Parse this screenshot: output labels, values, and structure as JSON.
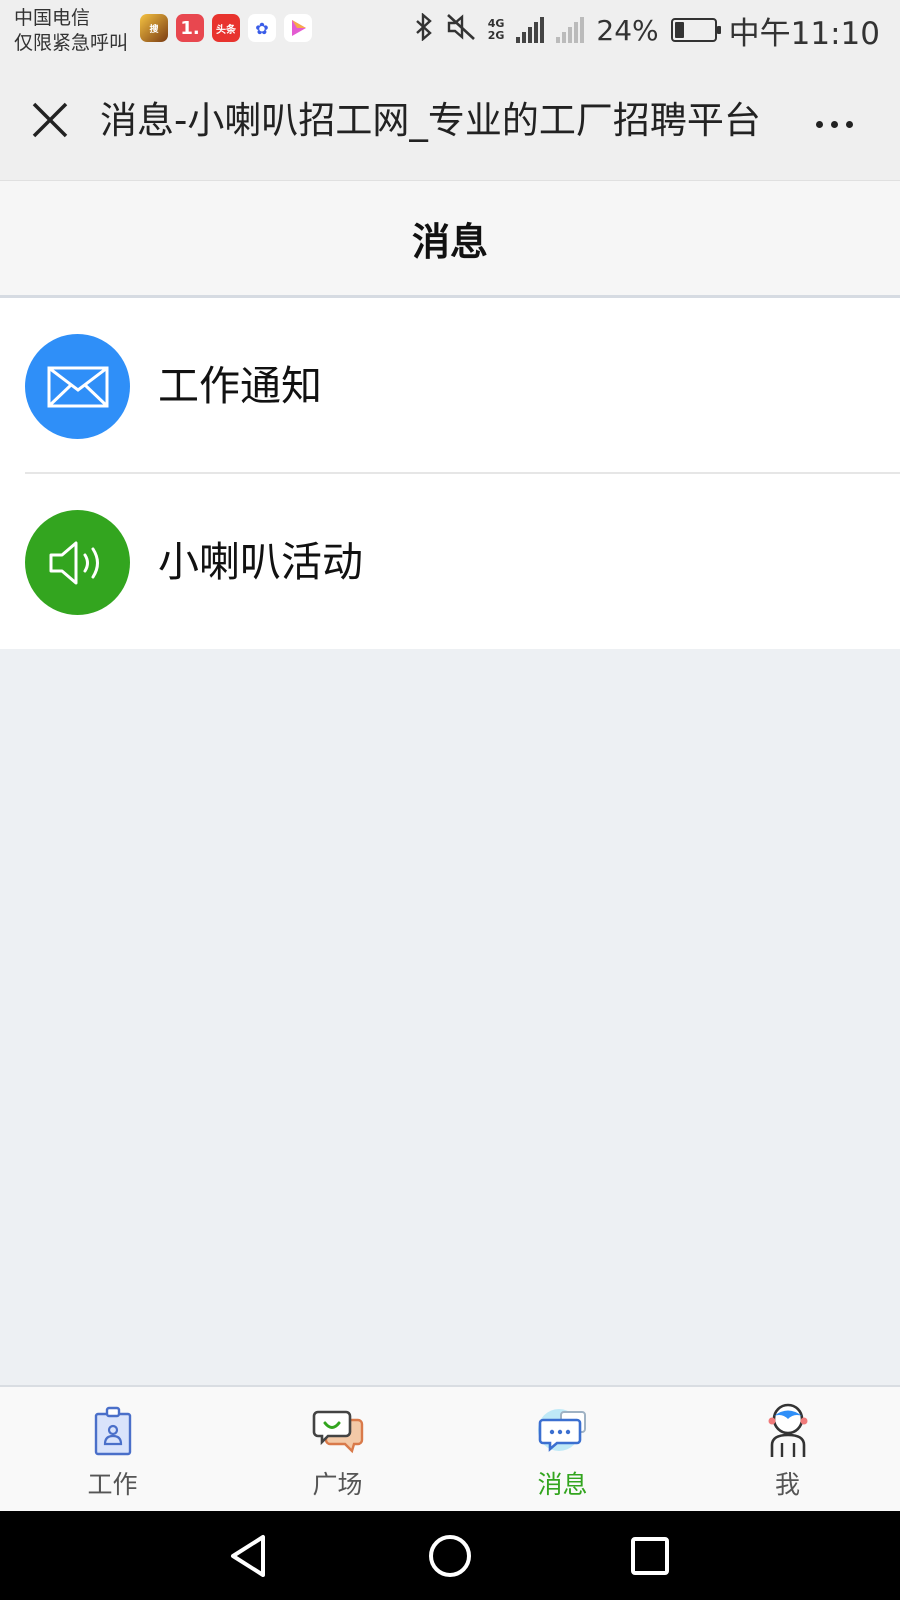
{
  "status_bar": {
    "carrier_line1": "中国电信",
    "carrier_line2": "仅限紧急呼叫",
    "notification_icons": [
      "sogou-app-icon",
      "one-app-icon",
      "toutiao-app-icon",
      "baidu-app-icon",
      "video-app-icon"
    ],
    "network_type_top": "4G",
    "network_type_bottom": "2G",
    "battery_percent_text": "24%",
    "battery_level": 0.24,
    "time": "中午11:10"
  },
  "header": {
    "title": "消息-小喇叭招工网_专业的工厂招聘平台",
    "close_icon": "close-icon",
    "more_icon": "more-icon"
  },
  "page": {
    "heading": "消息"
  },
  "messages": [
    {
      "label": "工作通知",
      "icon": "envelope-icon",
      "color": "#2f8ff8"
    },
    {
      "label": "小喇叭活动",
      "icon": "speaker-icon",
      "color": "#33a51f"
    }
  ],
  "tabs": [
    {
      "label": "工作",
      "icon": "work-badge-icon",
      "active": false
    },
    {
      "label": "广场",
      "icon": "chat-bubbles-icon",
      "active": false
    },
    {
      "label": "消息",
      "icon": "message-icon",
      "active": true
    },
    {
      "label": "我",
      "icon": "person-icon",
      "active": false
    }
  ],
  "colors": {
    "accent_green": "#33a51f",
    "accent_blue": "#2f8ff8",
    "background": "#edf0f3"
  }
}
